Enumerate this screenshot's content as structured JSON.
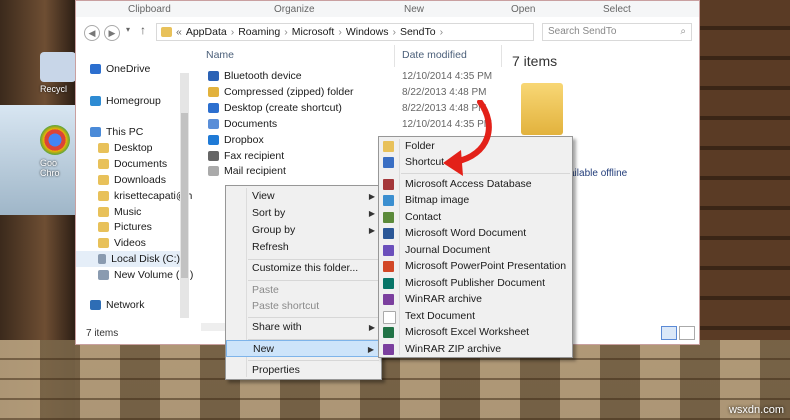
{
  "ribbon": {
    "groups": [
      "Clipboard",
      "Organize",
      "New",
      "Open",
      "Select"
    ]
  },
  "address": {
    "path": [
      "AppData",
      "Roaming",
      "Microsoft",
      "Windows",
      "SendTo"
    ],
    "prefix": "«"
  },
  "search": {
    "placeholder": "Search SendTo"
  },
  "nav": {
    "items": [
      "OneDrive",
      "Homegroup",
      "This PC",
      "Desktop",
      "Documents",
      "Downloads",
      "krisettecapati@h",
      "Music",
      "Pictures",
      "Videos",
      "Local Disk (C:)",
      "New Volume (D:)",
      "Network"
    ]
  },
  "columns": {
    "name": "Name",
    "date": "Date modified"
  },
  "files": [
    {
      "name": "Bluetooth device",
      "date": "12/10/2014 4:35 PM",
      "color": "#2b62b5"
    },
    {
      "name": "Compressed (zipped) folder",
      "date": "8/22/2013 4:48 PM",
      "color": "#e2b23d"
    },
    {
      "name": "Desktop (create shortcut)",
      "date": "8/22/2013 4:48 PM",
      "color": "#2c6fcf"
    },
    {
      "name": "Documents",
      "date": "12/10/2014 4:35 PM",
      "color": "#5a8ed8"
    },
    {
      "name": "Dropbox",
      "date": "",
      "color": "#1f7ad6"
    },
    {
      "name": "Fax recipient",
      "date": "",
      "color": "#666666"
    },
    {
      "name": "Mail recipient",
      "date": "",
      "color": "#aaaaaa"
    }
  ],
  "details": {
    "count_title": "7 items",
    "offline_text": "vailable offline"
  },
  "status": {
    "count": "7 items"
  },
  "context_menu": {
    "items": [
      "View",
      "Sort by",
      "Group by",
      "Refresh",
      "Customize this folder...",
      "Paste",
      "Paste shortcut",
      "Share with",
      "New",
      "Properties"
    ]
  },
  "new_menu": {
    "items": [
      "Folder",
      "Shortcut",
      "Microsoft Access Database",
      "Bitmap image",
      "Contact",
      "Microsoft Word Document",
      "Journal Document",
      "Microsoft PowerPoint Presentation",
      "Microsoft Publisher Document",
      "WinRAR archive",
      "Text Document",
      "Microsoft Excel Worksheet",
      "WinRAR ZIP archive"
    ],
    "icon_colors": [
      "#e8c15a",
      "#3a6fc4",
      "#a4373a",
      "#3b8fd0",
      "#5b8a3a",
      "#2b5797",
      "#6b4fbb",
      "#d24726",
      "#077568",
      "#7b3f9e",
      "#bbbbbb",
      "#217346",
      "#7b3f9e"
    ]
  },
  "desktop": {
    "label1": "Recycl",
    "label2": "Goo Chro"
  },
  "watermark": "wsxdn.com",
  "accent": "#e32119"
}
